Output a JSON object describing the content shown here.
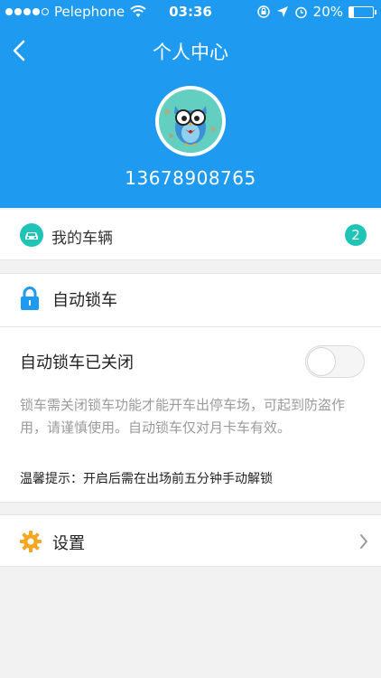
{
  "status_bar": {
    "carrier": "Pelephone",
    "time": "03:36",
    "battery_text": "20%",
    "battery_level": 0.2
  },
  "nav": {
    "title": "个人中心"
  },
  "profile": {
    "phone": "13678908765"
  },
  "vehicles": {
    "label": "我的车辆",
    "count": "2"
  },
  "auto_lock": {
    "title": "自动锁车",
    "toggle_label": "自动锁车已关闭",
    "toggle_on": false,
    "description": "锁车需关闭锁车功能才能开车出停车场，可起到防盗作用，请谨慎使用。自动锁车仅对月卡车有效。",
    "tip": "温馨提示：开启后需在出场前五分钟手动解锁"
  },
  "settings": {
    "label": "设置"
  },
  "colors": {
    "header": "#1e9af1",
    "badge": "#20c4b6",
    "gear": "#f5a623"
  }
}
